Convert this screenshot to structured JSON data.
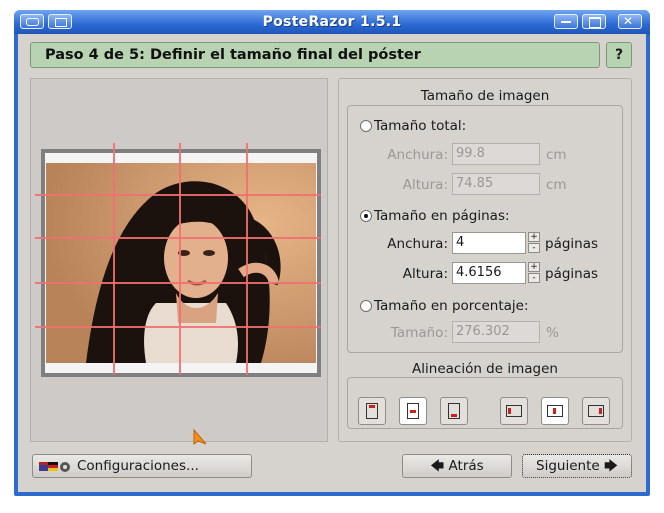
{
  "window": {
    "title": "PosteRazor 1.5.1"
  },
  "header": {
    "step_title": "Paso 4 de 5: Definir el tamaño final del póster",
    "help_label": "?"
  },
  "image_size": {
    "section_title": "Tamaño de imagen",
    "total": {
      "label": "Tamaño total:",
      "width_label": "Anchura:",
      "width_value": "99.8",
      "width_unit": "cm",
      "height_label": "Altura:",
      "height_value": "74.85",
      "height_unit": "cm",
      "selected": false
    },
    "pages": {
      "label": "Tamaño en páginas:",
      "width_label": "Anchura:",
      "width_value": "4",
      "width_unit": "páginas",
      "height_label": "Altura:",
      "height_value": "4.6156",
      "height_unit": "páginas",
      "selected": true
    },
    "percent": {
      "label": "Tamaño en porcentaje:",
      "size_label": "Tamaño:",
      "size_value": "276.302",
      "size_unit": "%",
      "selected": false
    }
  },
  "alignment": {
    "section_title": "Alineación de imagen",
    "buttons": [
      {
        "name": "align-top",
        "icon": "align-top-icon"
      },
      {
        "name": "align-vcenter",
        "icon": "align-vcenter-icon",
        "selected": true
      },
      {
        "name": "align-bottom",
        "icon": "align-bottom-icon"
      },
      {
        "name": "align-left",
        "icon": "align-left-icon"
      },
      {
        "name": "align-hcenter",
        "icon": "align-hcenter-icon",
        "selected": true
      },
      {
        "name": "align-right",
        "icon": "align-right-icon"
      }
    ]
  },
  "footer": {
    "settings_label": "Configuraciones...",
    "back_label": "Atrás",
    "next_label": "Siguiente"
  },
  "colors": {
    "titlebar": "#2c69d3",
    "header_bg": "#b8d3b2",
    "grid_lines": "#f07070",
    "panel_bg": "#d6d3cf"
  }
}
